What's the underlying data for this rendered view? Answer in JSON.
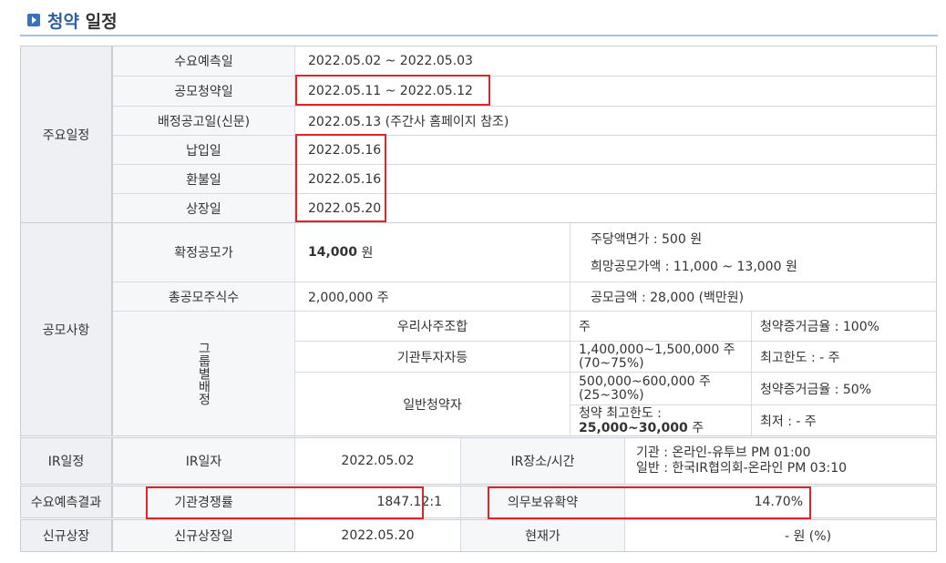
{
  "header": {
    "title_highlight": "청약",
    "title_rest": "일정"
  },
  "schedule": {
    "category": "주요일정",
    "rows": [
      {
        "label": "수요예측일",
        "value": "2022.05.02  ~  2022.05.03"
      },
      {
        "label": "공모청약일",
        "value": "2022.05.11  ~  2022.05.12"
      },
      {
        "label": "배정공고일(신문)",
        "value": "2022.05.13 (주간사 홈페이지 참조)"
      },
      {
        "label": "납입일",
        "value": "2022.05.16"
      },
      {
        "label": "환불일",
        "value": "2022.05.16"
      },
      {
        "label": "상장일",
        "value": "2022.05.20"
      }
    ]
  },
  "offering": {
    "category": "공모사항",
    "confirmed_price_label": "확정공모가",
    "confirmed_price_value": "14,000",
    "confirmed_price_unit": "원",
    "par_value": "주당액면가 :  500 원",
    "desired_price": "희망공모가액 :  11,000 ~ 13,000 원",
    "total_shares_label": "총공모주식수",
    "total_shares_value": "2,000,000 주",
    "offer_amount": "공모금액 : 28,000 (백만원)",
    "group_label": "그룹별배정",
    "groups": [
      {
        "name": "우리사주조합",
        "shares": "주",
        "note": "청약증거금율 : 100%"
      },
      {
        "name": "기관투자자등",
        "shares": "1,400,000~1,500,000 주",
        "shares2": "(70~75%)",
        "note": "최고한도 :  - 주"
      },
      {
        "name": "일반청약자",
        "shares": "500,000~600,000 주",
        "shares2": "(25~30%)",
        "note": "청약증거금율 : 50%",
        "limit_label": "청약 최고한도 :",
        "limit_value": "25,000~30,000",
        "limit_unit": "주",
        "min_note": "최저 :  - 주"
      }
    ]
  },
  "ir": {
    "category": "IR일정",
    "date_label": "IR일자",
    "date_value": "2022.05.02",
    "place_label": "IR장소/시간",
    "place_line1": "기관 : 온라인-유투브 PM 01:00",
    "place_line2": "일반 : 한국IR협의회-온라인 PM 03:10"
  },
  "demand": {
    "category": "수요예측결과",
    "competition_label": "기관경쟁률",
    "competition_value": "1847.12:1",
    "lockup_label": "의무보유확약",
    "lockup_value": "14.70%"
  },
  "listing": {
    "category": "신규상장",
    "date_label": "신규상장일",
    "date_value": "2022.05.20",
    "price_label": "현재가",
    "price_value": "- 원 (%)"
  }
}
